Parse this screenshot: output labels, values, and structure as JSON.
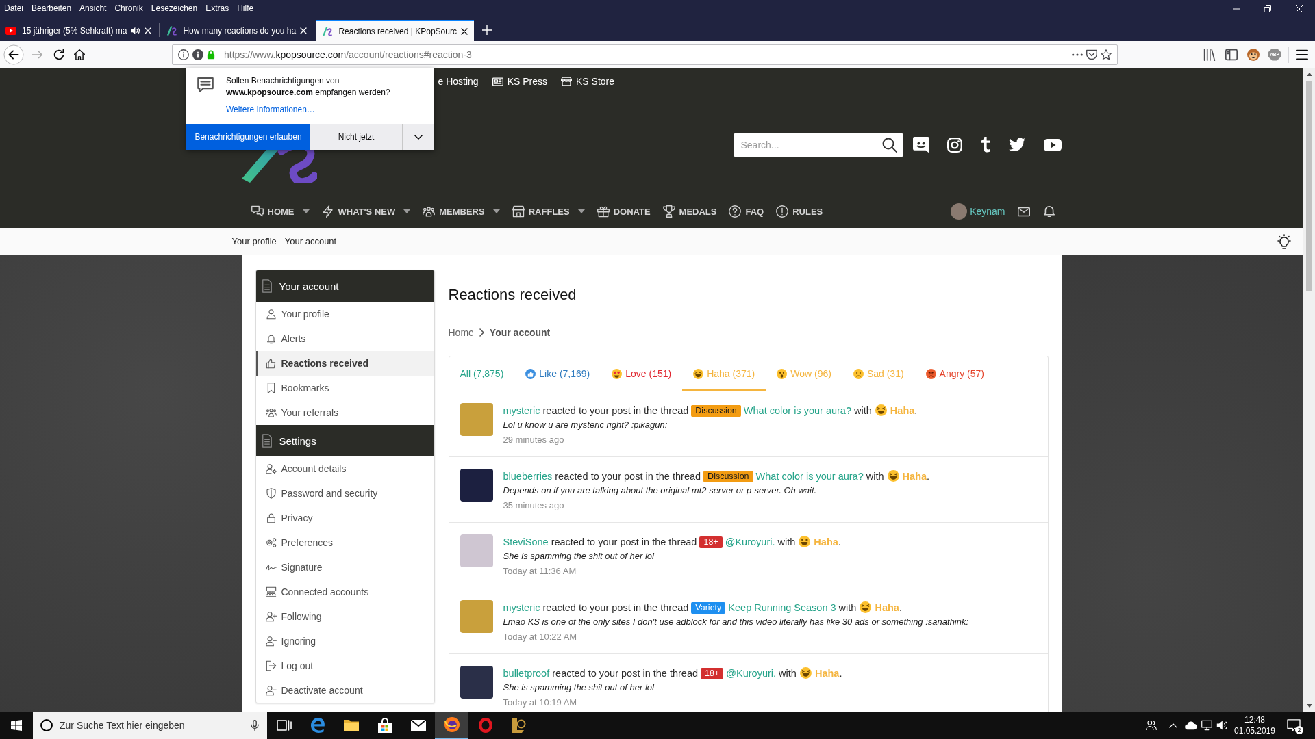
{
  "browser": {
    "menu": [
      "Datei",
      "Bearbeiten",
      "Ansicht",
      "Chronik",
      "Lesezeichen",
      "Extras",
      "Hilfe"
    ],
    "tabs": [
      {
        "title": "15 jähriger (5% Sehkraft) ma",
        "kind": "video",
        "playing": true,
        "selected": false
      },
      {
        "title": "How many reactions do you ha",
        "kind": "site",
        "playing": false,
        "selected": false
      },
      {
        "title": "Reactions received | KPopSourc",
        "kind": "site",
        "playing": false,
        "selected": true
      }
    ],
    "url": "https://www.**kpopsource.com**/account/reactions#reaction-3",
    "extension_badge": "ABP"
  },
  "notification": {
    "message": "Sollen Benachrichtigungen von **www.kpopsource.com** empfangen werden?",
    "link": "Weitere Informationen…",
    "allow": "Benachrichtigungen erlauben",
    "deny": "Nicht jetzt"
  },
  "header": {
    "links": [
      {
        "label": "e Hosting"
      },
      {
        "label": "KS Press",
        "kind": "press"
      },
      {
        "label": "KS Store",
        "kind": "store"
      }
    ],
    "search": {
      "placeholder": "Search..."
    },
    "nav": [
      {
        "label": "HOME",
        "kind": "home",
        "has_menu": true
      },
      {
        "label": "WHAT'S NEW",
        "kind": "news",
        "has_menu": true
      },
      {
        "label": "MEMBERS",
        "kind": "members",
        "has_menu": true
      },
      {
        "label": "RAFFLES",
        "kind": "raffles",
        "has_menu": true
      },
      {
        "label": "DONATE",
        "kind": "donate",
        "has_menu": false
      },
      {
        "label": "MEDALS",
        "kind": "medals",
        "has_menu": false
      },
      {
        "label": "FAQ",
        "kind": "faq",
        "has_menu": false
      },
      {
        "label": "RULES",
        "kind": "rules",
        "has_menu": false
      }
    ],
    "user": {
      "name": "Keynam"
    }
  },
  "subnav": [
    "Your profile",
    "Your account"
  ],
  "sidebar": {
    "sections": [
      {
        "title": "Your account",
        "items": [
          {
            "label": "Your profile",
            "kind": "profile",
            "selected": false
          },
          {
            "label": "Alerts",
            "kind": "alerts",
            "selected": false
          },
          {
            "label": "Reactions received",
            "kind": "reactions",
            "selected": true
          },
          {
            "label": "Bookmarks",
            "kind": "bookmarks",
            "selected": false
          },
          {
            "label": "Your referrals",
            "kind": "referrals",
            "selected": false
          }
        ]
      },
      {
        "title": "Settings",
        "items": [
          {
            "label": "Account details",
            "kind": "account",
            "selected": false
          },
          {
            "label": "Password and security",
            "kind": "security",
            "selected": false
          },
          {
            "label": "Privacy",
            "kind": "privacy",
            "selected": false
          },
          {
            "label": "Preferences",
            "kind": "preferences",
            "selected": false
          },
          {
            "label": "Signature",
            "kind": "signature",
            "selected": false
          },
          {
            "label": "Connected accounts",
            "kind": "connected",
            "selected": false
          },
          {
            "label": "Following",
            "kind": "following",
            "selected": false
          },
          {
            "label": "Ignoring",
            "kind": "ignoring",
            "selected": false
          },
          {
            "label": "Log out",
            "kind": "logout",
            "selected": false
          },
          {
            "label": "Deactivate account",
            "kind": "deactivate",
            "selected": false
          }
        ]
      }
    ]
  },
  "main": {
    "title": "Reactions received",
    "breadcrumb": [
      {
        "label": "Home",
        "current": false
      },
      {
        "label": "Your account",
        "current": true
      }
    ],
    "tabs": [
      {
        "label": "All (7,875)",
        "kind": "all",
        "color": "#26a48a",
        "selected": false
      },
      {
        "label": "Like (7,169)",
        "kind": "like",
        "color": "#2f7bbf",
        "selected": false
      },
      {
        "label": "Love (151)",
        "kind": "love",
        "color": "#e0262f",
        "selected": false
      },
      {
        "label": "Haha (371)",
        "kind": "haha",
        "color": "#f5b53f",
        "selected": true
      },
      {
        "label": "Wow (96)",
        "kind": "wow",
        "color": "#f5b53f",
        "selected": false
      },
      {
        "label": "Sad (31)",
        "kind": "sad",
        "color": "#f5b53f",
        "selected": false
      },
      {
        "label": "Angry (57)",
        "kind": "angry",
        "color": "#e5452c",
        "selected": false
      }
    ],
    "reactions": [
      {
        "avatar": {
          "color": "#c9a03c"
        },
        "user": "mysteric",
        "action": "reacted to your post in the thread",
        "prefix": {
          "label": "Discussion",
          "color": "#f39c12"
        },
        "thread": "What color is your aura?",
        "connector": "with",
        "reaction": {
          "kind": "haha",
          "label": "Haha"
        },
        "end": ".",
        "quote": "Lol u know u are mysteric right? :pikagun:",
        "time": "29 minutes ago"
      },
      {
        "avatar": {
          "color": "#1c2040"
        },
        "user": "blueberries",
        "action": "reacted to your post in the thread",
        "prefix": {
          "label": "Discussion",
          "color": "#f39c12"
        },
        "thread": "What color is your aura?",
        "connector": "with",
        "reaction": {
          "kind": "haha",
          "label": "Haha"
        },
        "end": ".",
        "quote": "Depends on if you are talking about the original mt2 server or p-server. Oh wait.",
        "time": "35 minutes ago"
      },
      {
        "avatar": {
          "color": "#cfc6d2"
        },
        "user": "SteviSone",
        "action": "reacted to your post in the thread",
        "prefix": {
          "label": "18+",
          "color": "#d32f2f"
        },
        "thread": "@Kuroyuri.",
        "connector": "with",
        "reaction": {
          "kind": "haha",
          "label": "Haha"
        },
        "end": ".",
        "quote": "She is spamming the shit out of her lol",
        "time": "Today at 11:36 AM"
      },
      {
        "avatar": {
          "color": "#c9a03c"
        },
        "user": "mysteric",
        "action": "reacted to your post in the thread",
        "prefix": {
          "label": "Variety",
          "color": "#1e8ff0"
        },
        "thread": "Keep Running Season 3",
        "connector": "with",
        "reaction": {
          "kind": "haha",
          "label": "Haha"
        },
        "end": ".",
        "quote": "Lmao KS is one of the only sites I don't use adblock for and this video literally has like 30 ads or something :sanathink:",
        "time": "Today at 10:22 AM"
      },
      {
        "avatar": {
          "color": "#2a2f48"
        },
        "user": "bulletproof",
        "action": "reacted to your post in the thread",
        "prefix": {
          "label": "18+",
          "color": "#d32f2f"
        },
        "thread": "@Kuroyuri.",
        "connector": "with",
        "reaction": {
          "kind": "haha",
          "label": "Haha"
        },
        "end": ".",
        "quote": "She is spamming the shit out of her lol",
        "time": "Today at 10:19 AM"
      }
    ]
  },
  "taskbar": {
    "search": {
      "placeholder": "Zur Suche Text hier eingeben"
    },
    "apps": [
      {
        "kind": "taskview",
        "active": false
      },
      {
        "kind": "edge",
        "active": false
      },
      {
        "kind": "explorer",
        "active": false
      },
      {
        "kind": "store",
        "active": false
      },
      {
        "kind": "mail",
        "active": false
      },
      {
        "kind": "firefox",
        "active": true
      },
      {
        "kind": "opera",
        "active": false
      },
      {
        "kind": "league",
        "active": false
      }
    ],
    "time": "12:48",
    "date": "01.05.2019",
    "notifications": "2"
  }
}
